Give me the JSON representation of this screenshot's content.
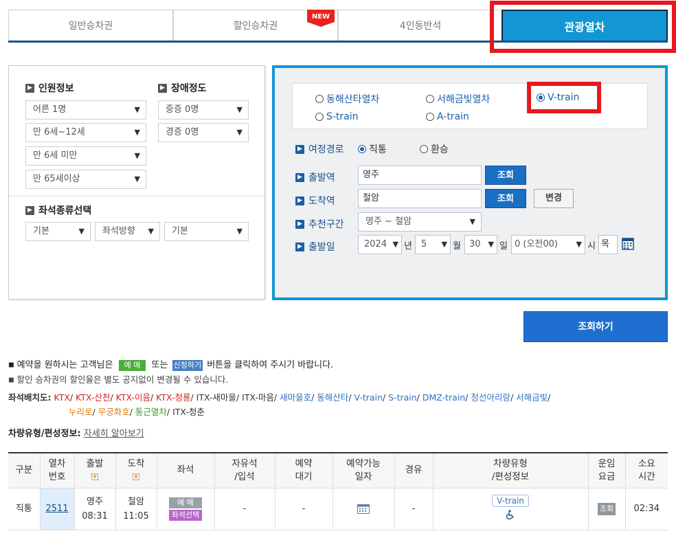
{
  "tabs": [
    {
      "label": "일반승차권"
    },
    {
      "label": "할인승차권",
      "badge": "NEW"
    },
    {
      "label": "4인동반석"
    },
    {
      "label": "관광열차",
      "active": true
    }
  ],
  "passenger": {
    "title": "인원정보",
    "adult": "어른 1명",
    "child": "만 6세~12세",
    "infant": "만 6세 미만",
    "senior": "만 65세이상"
  },
  "disability": {
    "title": "장애정도",
    "severe": "중증 0명",
    "mild": "경증 0명"
  },
  "seat_type": {
    "title": "좌석종류선택",
    "kind": "기본",
    "direction": "좌석방향",
    "option": "기본"
  },
  "train_types": [
    {
      "label": "동해산타열차",
      "checked": false
    },
    {
      "label": "서해금빛열차",
      "checked": false
    },
    {
      "label": "V-train",
      "checked": true
    },
    {
      "label": "S-train",
      "checked": false
    },
    {
      "label": "A-train",
      "checked": false
    }
  ],
  "route": {
    "label": "여정경로",
    "direct": "직통",
    "transfer": "환승"
  },
  "departure": {
    "label": "출발역",
    "value": "영주",
    "lookup": "조회"
  },
  "arrival": {
    "label": "도착역",
    "value": "철암",
    "lookup": "조회",
    "swap": "변경"
  },
  "recommend": {
    "label": "추천구간",
    "value": "영주 ~ 철암"
  },
  "date": {
    "label": "출발일",
    "year": "2024",
    "year_unit": "년",
    "month": "5",
    "month_unit": "월",
    "day": "30",
    "day_unit": "일",
    "hour": "0 (오전00)",
    "hour_unit": "시",
    "weekday": "목"
  },
  "search_button": "조회하기",
  "notice": {
    "line1_pre": "예약을 원하시는 고객님은",
    "tag_reserve": "예 매",
    "line1_mid": "또는",
    "tag_apply": "신청하기",
    "line1_post": "버튼을 클릭하여 주시기 바랍니다.",
    "line2": "할인 승차권의 할인율은 별도 공지없이 변경될 수 있습니다."
  },
  "seat_layout": {
    "label": "좌석배치도:",
    "items": [
      {
        "t": "KTX",
        "c": "r"
      },
      {
        "t": "KTX-산천",
        "c": "r"
      },
      {
        "t": "KTX-이음",
        "c": "r"
      },
      {
        "t": "KTX-청룡",
        "c": "r"
      },
      {
        "t": "ITX-새마을",
        "c": "k"
      },
      {
        "t": "ITX-마음",
        "c": "k"
      },
      {
        "t": "새마을호",
        "c": "b"
      },
      {
        "t": "동해산타",
        "c": "b"
      },
      {
        "t": "V-train",
        "c": "b"
      },
      {
        "t": "S-train",
        "c": "b"
      },
      {
        "t": "DMZ-train",
        "c": "b"
      },
      {
        "t": "정선아리랑",
        "c": "b"
      },
      {
        "t": "서해금빛",
        "c": "b"
      },
      {
        "t": "누리로",
        "c": "o"
      },
      {
        "t": "무궁화호",
        "c": "o"
      },
      {
        "t": "통근열차",
        "c": "g"
      },
      {
        "t": "ITX-청춘",
        "c": "k"
      }
    ]
  },
  "vehicle_info": {
    "label": "차량유형/편성정보:",
    "link": "자세히 알아보기"
  },
  "table": {
    "headers": [
      "구분",
      "열차\n번호",
      "출발",
      "도착",
      "좌석",
      "자유석\n/입석",
      "예약\n대기",
      "예약가능\n일자",
      "경유",
      "차량유형\n/편성정보",
      "운임\n요금",
      "소요\n시간"
    ],
    "rows": [
      {
        "type": "직통",
        "train_no": "2511",
        "dep_station": "영주",
        "dep_time": "08:31",
        "arr_station": "철암",
        "arr_time": "11:05",
        "seat_reserve": "예 매",
        "seat_select": "좌석선택",
        "free": "-",
        "wait": "-",
        "via": "-",
        "vehicle": "V-train",
        "fare": "조회",
        "duration": "02:34"
      }
    ]
  }
}
